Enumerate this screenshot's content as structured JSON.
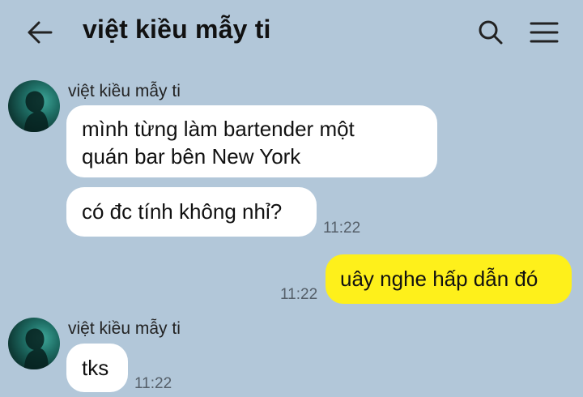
{
  "header": {
    "title": "việt kiều mẫy ti",
    "back_icon": "back-arrow-icon",
    "search_icon": "search-icon",
    "menu_icon": "menu-icon"
  },
  "colors": {
    "background": "#b2c7d9",
    "incoming_bubble": "#ffffff",
    "outgoing_bubble": "#fef01b"
  },
  "messages": [
    {
      "direction": "incoming",
      "sender": "việt kiều mẫy ti",
      "lines": [
        "mình từng làm bartender một",
        "quán bar bên New York"
      ],
      "time": ""
    },
    {
      "direction": "incoming",
      "lines": [
        "có đc tính không nhỉ?"
      ],
      "time": "11:22"
    },
    {
      "direction": "outgoing",
      "lines": [
        "uây nghe hấp dẫn đó"
      ],
      "time": "11:22"
    },
    {
      "direction": "incoming",
      "sender": "việt kiều mẫy ti",
      "lines": [
        "tks"
      ],
      "time": "11:22"
    }
  ]
}
